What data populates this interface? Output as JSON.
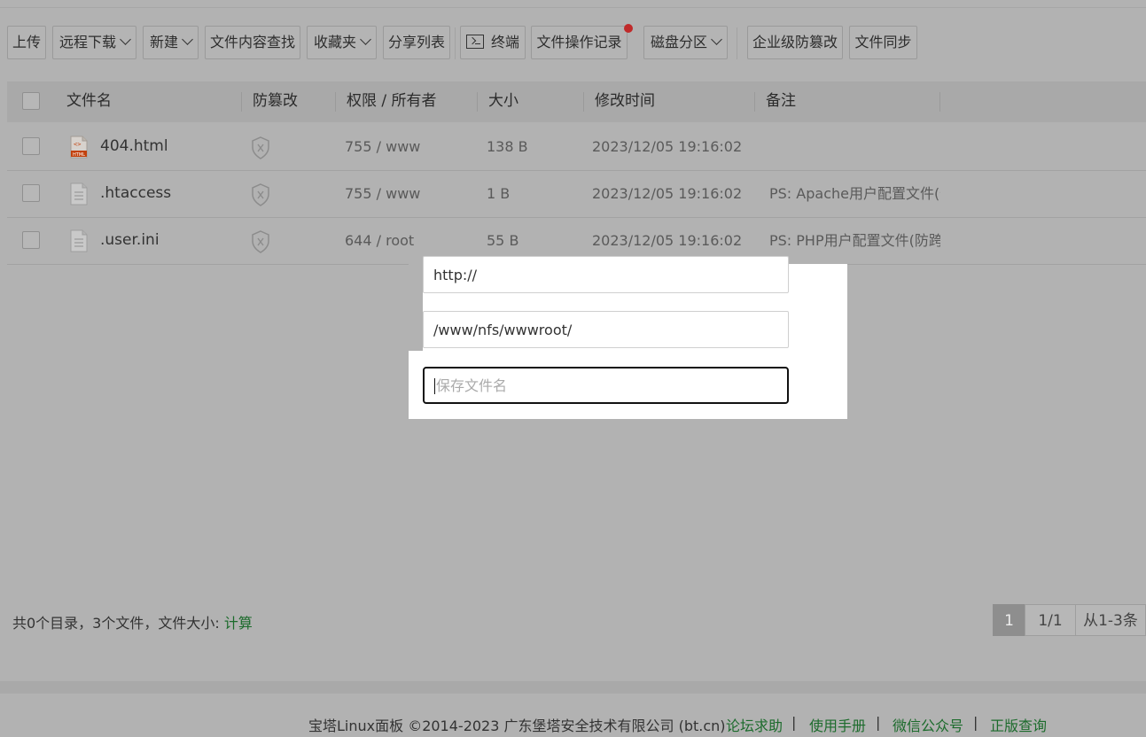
{
  "toolbar": {
    "upload": "上传",
    "remote_download": "远程下载",
    "new": "新建",
    "content_search": "文件内容查找",
    "favorites": "收藏夹",
    "share_list": "分享列表",
    "terminal": "终端",
    "operation_log": "文件操作记录",
    "disk_partition": "磁盘分区",
    "tamper_proof": "企业级防篡改",
    "file_sync": "文件同步"
  },
  "table": {
    "headers": {
      "name": "文件名",
      "tamper": "防篡改",
      "perm_owner": "权限 / 所有者",
      "size": "大小",
      "mtime": "修改时间",
      "note": "备注"
    },
    "rows": [
      {
        "name": "404.html",
        "type": "html-file-icon",
        "perm": "755 / www",
        "size": "138 B",
        "mtime": "2023/12/05 19:16:02",
        "note": ""
      },
      {
        "name": ".htaccess",
        "type": "text-file-icon",
        "perm": "755 / www",
        "size": "1 B",
        "mtime": "2023/12/05 19:16:02",
        "note": "PS: Apache用户配置文件(伪"
      },
      {
        "name": ".user.ini",
        "type": "text-file-icon",
        "perm": "644 / root",
        "size": "55 B",
        "mtime": "2023/12/05 19:16:02",
        "note": "PS: PHP用户配置文件(防跨"
      }
    ]
  },
  "dialog": {
    "url_value": "http://",
    "path_value": "/www/nfs/wwwroot/",
    "filename_placeholder": "保存文件名"
  },
  "summary": {
    "text": "共0个目录，3个文件，文件大小: ",
    "calc_link": "计算"
  },
  "pagination": {
    "current": "1",
    "total": "1/1",
    "range": "从1-3条"
  },
  "footer": {
    "copyright": "宝塔Linux面板 ©2014-2023 广东堡塔安全技术有限公司 (bt.cn)",
    "links": [
      "论坛求助",
      "使用手册",
      "微信公众号",
      "正版查询"
    ],
    "separator": "|"
  },
  "colors": {
    "overlay_bg": "#b2b2b2",
    "link_green": "#1c6b2c",
    "notification_red": "#c02a2a"
  }
}
